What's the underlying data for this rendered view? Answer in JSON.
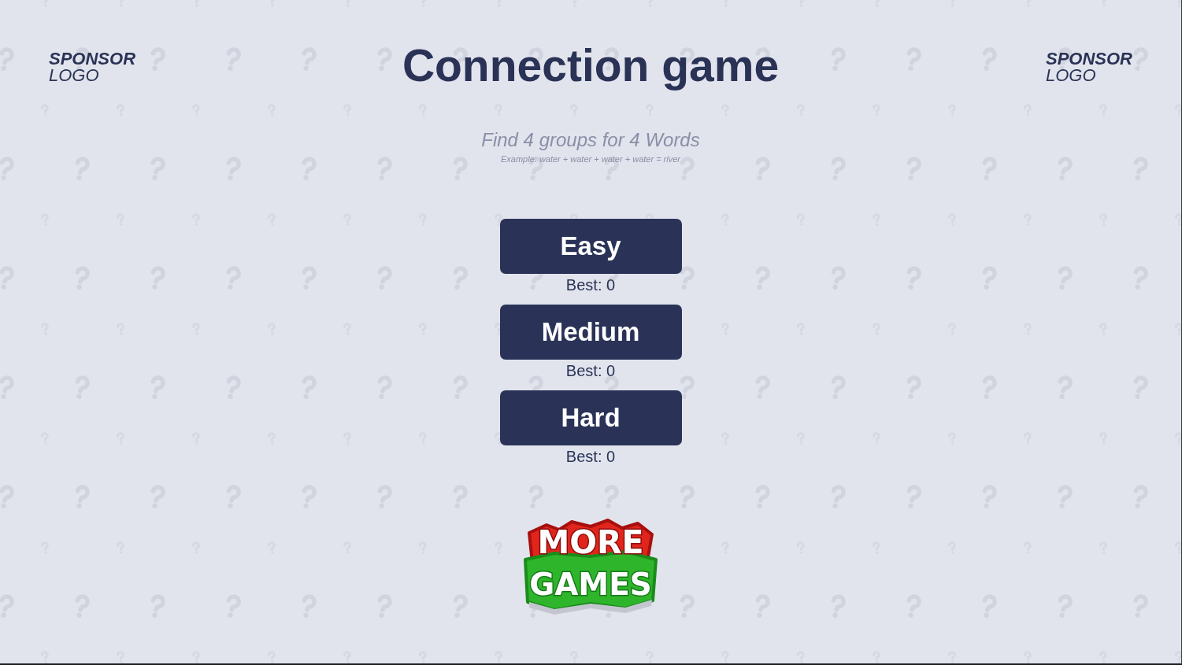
{
  "header": {
    "left_logo": {
      "line_1": "SPONSOR",
      "line_2": "LOGO"
    },
    "title": "Connection game",
    "right_logo": {
      "line_1": "SPONSOR",
      "line_2": "LOGO"
    }
  },
  "intro": {
    "subtitle": "Find 4 groups for 4 Words",
    "example": "Example: water + water + water + water = river"
  },
  "levels": [
    {
      "label": "Easy",
      "best": "Best: 0"
    },
    {
      "label": "Medium",
      "best": "Best: 0"
    },
    {
      "label": "Hard",
      "best": "Best: 0"
    }
  ],
  "more_games": {
    "line_1": "MORE",
    "line_2": "GAMES"
  }
}
